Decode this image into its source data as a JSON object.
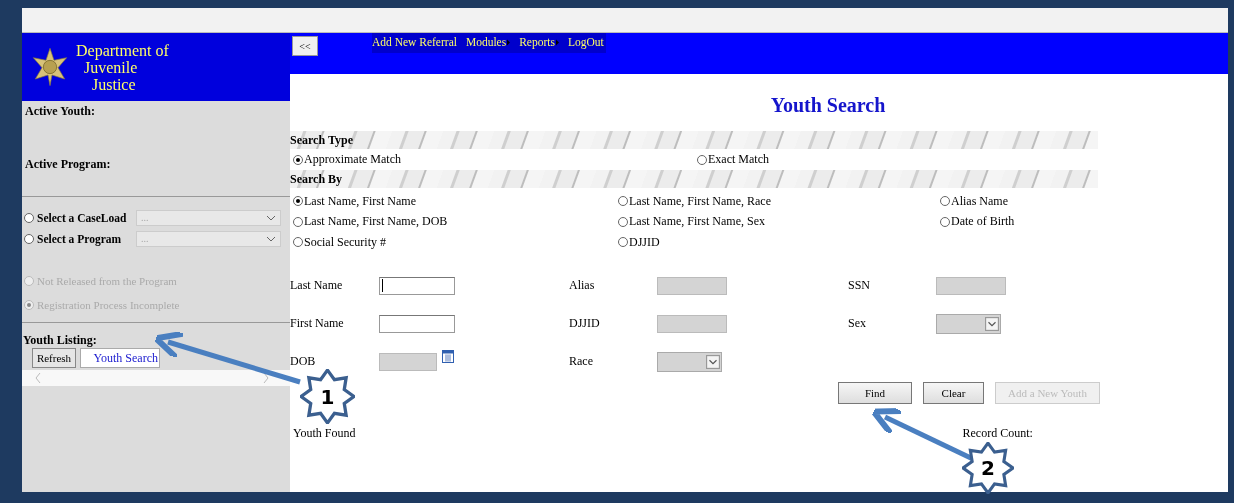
{
  "sidebar": {
    "logo_lines": [
      "Department of",
      "Juvenile",
      "Justice"
    ],
    "active_youth_label": "Active Youth:",
    "active_program_label": "Active Program:",
    "selectors": [
      {
        "label": "Select a CaseLoad",
        "value": "...",
        "selected": false
      },
      {
        "label": "Select a Program",
        "value": "...",
        "selected": false
      }
    ],
    "filters": [
      {
        "label": "Not Released from the Program",
        "selected": false,
        "disabled": true
      },
      {
        "label": "Registration Process Incomplete",
        "selected": true,
        "disabled": true
      }
    ],
    "listing_title": "Youth Listing:",
    "listing_buttons": [
      {
        "label": "Refresh",
        "selected": false
      },
      {
        "label": "Youth Search",
        "selected": true
      }
    ]
  },
  "nav": {
    "collapse_button": "<<",
    "menu": [
      {
        "label": "Add New Referral",
        "has_submenu": false
      },
      {
        "label": "Modules",
        "has_submenu": true
      },
      {
        "label": "Reports",
        "has_submenu": true
      },
      {
        "label": "LogOut",
        "has_submenu": false
      }
    ]
  },
  "page_title": "Youth Search",
  "search_type": {
    "title": "Search Type",
    "options": [
      {
        "label": "Approximate Match",
        "selected": true
      },
      {
        "label": "Exact Match",
        "selected": false
      }
    ]
  },
  "search_by": {
    "title": "Search By",
    "options": [
      {
        "label": "Last Name, First Name",
        "selected": true
      },
      {
        "label": "Last Name, First Name, Race",
        "selected": false
      },
      {
        "label": "Alias Name",
        "selected": false
      },
      {
        "label": "Last Name, First Name, DOB",
        "selected": false
      },
      {
        "label": "Last Name, First Name, Sex",
        "selected": false
      },
      {
        "label": "Date of Birth",
        "selected": false
      },
      {
        "label": "Social Security #",
        "selected": false
      },
      {
        "label": "DJJID",
        "selected": false
      }
    ]
  },
  "fields": [
    {
      "label": "Last Name",
      "kind": "text",
      "disabled": false
    },
    {
      "label": "Alias",
      "kind": "text",
      "disabled": true
    },
    {
      "label": "SSN",
      "kind": "text",
      "disabled": true
    },
    {
      "label": "First Name",
      "kind": "text",
      "disabled": false
    },
    {
      "label": "DJJID",
      "kind": "text",
      "disabled": true
    },
    {
      "label": "Sex",
      "kind": "select",
      "disabled": true
    },
    {
      "label": "DOB",
      "kind": "date",
      "disabled": true
    },
    {
      "label": "Race",
      "kind": "select",
      "disabled": true
    }
  ],
  "buttons": [
    {
      "label": "Find",
      "disabled": false
    },
    {
      "label": "Clear",
      "disabled": false
    },
    {
      "label": "Add a New Youth",
      "disabled": true
    }
  ],
  "youth_found_label": "Youth Found",
  "record_count_label": "Record Count:",
  "callouts": [
    {
      "number": "1"
    },
    {
      "number": "2"
    }
  ]
}
